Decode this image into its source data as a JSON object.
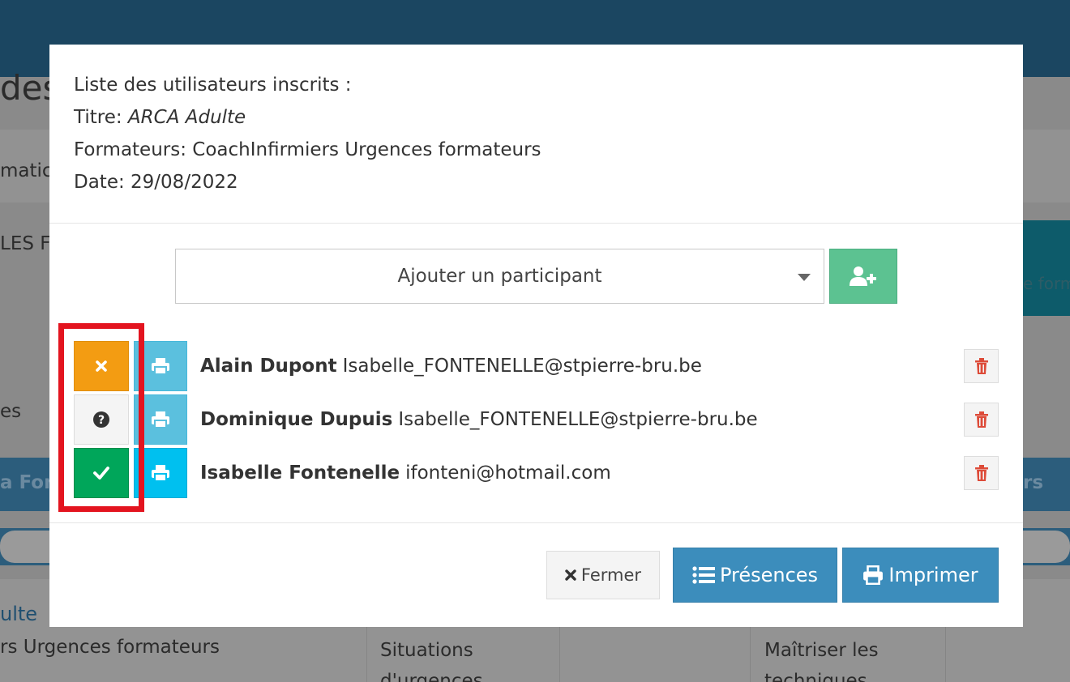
{
  "background": {
    "heading_fragment": "des",
    "nav_fragment": "matic",
    "item_fragment": "LES FO",
    "side_fragment": "es",
    "band_left": "a For",
    "band_right": "rs",
    "side_btn_label": "e form",
    "link_fragment": "ulte",
    "trainers_fragment": "rs Urgences formateurs",
    "col1_text": "Situations\nd'urgences",
    "col3_text": "Maîtriser les\ntechniques"
  },
  "modal": {
    "heading": "Liste des utilisateurs inscrits :",
    "title_label": "Titre: ",
    "title_value": "ARCA Adulte",
    "trainers_line": "Formateurs: CoachInfirmiers Urgences formateurs",
    "date_line": "Date: 29/08/2022",
    "select_placeholder": "Ajouter un participant",
    "add_icon": "user-plus-icon",
    "participants": [
      {
        "status": "absent",
        "status_icon": "times-icon",
        "status_color": "#f39c12",
        "name": "Alain Dupont",
        "email": "Isabelle_FONTENELLE@stpierre-bru.be"
      },
      {
        "status": "unknown",
        "status_icon": "question-circle-icon",
        "status_color": "#f4f4f4",
        "name": "Dominique Dupuis",
        "email": "Isabelle_FONTENELLE@stpierre-bru.be"
      },
      {
        "status": "present",
        "status_icon": "check-icon",
        "status_color": "#00a65a",
        "name": "Isabelle Fontenelle",
        "email": "ifonteni@hotmail.com"
      }
    ],
    "buttons": {
      "close": "Fermer",
      "attendance": "Présences",
      "print": "Imprimer"
    }
  },
  "colors": {
    "primary": "#3c8dbc",
    "success": "#00a65a",
    "warning": "#f39c12",
    "danger": "#dd4b39",
    "highlight": "#e3141f"
  }
}
